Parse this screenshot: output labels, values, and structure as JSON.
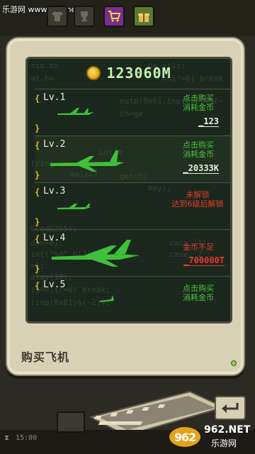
{
  "watermark_top": "乐游网 www.962.net",
  "coins": "123060M",
  "title": "购买飞机",
  "levels": [
    {
      "label": "Lv.1",
      "status_line1": "点击购买",
      "status_line2": "消耗金币",
      "price": "_123",
      "status_color": "green"
    },
    {
      "label": "Lv.2",
      "status_line1": "点击购买",
      "status_line2": "消耗金币",
      "price": "_20333K",
      "status_color": "green"
    },
    {
      "label": "Lv.3",
      "status_line1": "未解锁",
      "status_line2": "达到6级后解锁",
      "price": "",
      "status_color": "red"
    },
    {
      "label": "Lv.4",
      "status_line1": "金币不足",
      "status_line2": "",
      "price": "_700000T",
      "status_color": "red"
    },
    {
      "label": "Lv.5",
      "status_line1": "点击购买",
      "status_line2": "消耗金币",
      "price": "",
      "status_color": "green"
    }
  ],
  "code_lines": [
    "<io.h>",
    "de y(1);",
    "at.h>",
    "nhi!=0) break",
    "outp(0x61,inp(0x61)&(~",
    "ch=ge",
    "int m",
    "tring",
    "main()",
    "getch(",
    "key);",
    "&cod&255);",
    "do>>8);",
    "case '1':",
    "int(\"%d\",0[3]);",
    "case '2':",
    "=1;",
    "elay(10);",
    "break;",
    "(i=0;i!=0) break;",
    "(inp(0x61)&(~2));"
  ],
  "clock": "15:00",
  "watermark_bottom": {
    "brand": "962.NET",
    "sub": "乐游网"
  },
  "icons": {
    "top_buttons": [
      "shirt-icon",
      "trophy-icon",
      "cart-icon",
      "gift-icon"
    ],
    "coin": "coin-icon",
    "back": "return-arrow-icon",
    "clock": "hourglass-icon"
  },
  "colors": {
    "screen_bg": "#1d2a1f",
    "accent_green": "#4ac23d",
    "warn_red": "#e53b2c",
    "coin_text": "#c3f2b0",
    "bracket": "#e0b83a"
  }
}
